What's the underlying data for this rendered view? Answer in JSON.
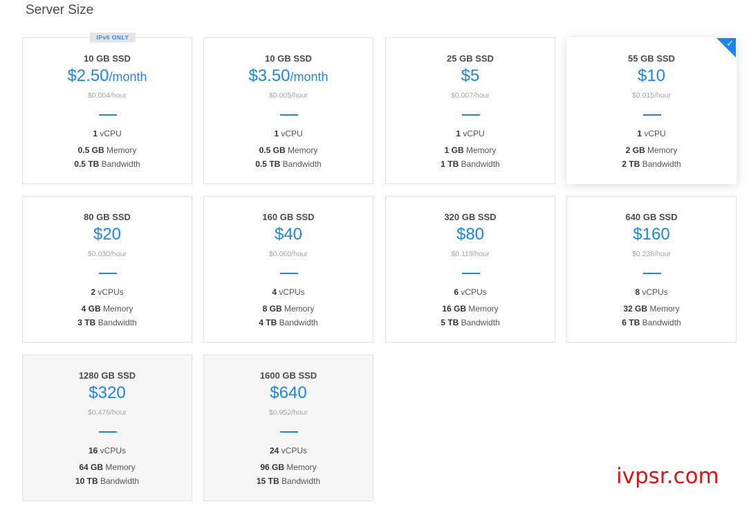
{
  "section_title": "Server Size",
  "plans": [
    {
      "storage": "10 GB SSD",
      "price": "$2.50",
      "unit": "/month",
      "hourly": "$0.004/hour",
      "cpu_num": "1",
      "cpu_label": "vCPU",
      "mem_num": "0.5 GB",
      "mem_label": "Memory",
      "bw_num": "0.5 TB",
      "bw_label": "Bandwidth",
      "badge": "IPv6 ONLY"
    },
    {
      "storage": "10 GB SSD",
      "price": "$3.50",
      "unit": "/month",
      "hourly": "$0.005/hour",
      "cpu_num": "1",
      "cpu_label": "vCPU",
      "mem_num": "0.5 GB",
      "mem_label": "Memory",
      "bw_num": "0.5 TB",
      "bw_label": "Bandwidth"
    },
    {
      "storage": "25 GB SSD",
      "price": "$5",
      "unit": "",
      "hourly": "$0.007/hour",
      "cpu_num": "1",
      "cpu_label": "vCPU",
      "mem_num": "1 GB",
      "mem_label": "Memory",
      "bw_num": "1 TB",
      "bw_label": "Bandwidth"
    },
    {
      "storage": "55 GB SSD",
      "price": "$10",
      "unit": "",
      "hourly": "$0.015/hour",
      "cpu_num": "1",
      "cpu_label": "vCPU",
      "mem_num": "2 GB",
      "mem_label": "Memory",
      "bw_num": "2 TB",
      "bw_label": "Bandwidth",
      "selected": true
    },
    {
      "storage": "80 GB SSD",
      "price": "$20",
      "unit": "",
      "hourly": "$0.030/hour",
      "cpu_num": "2",
      "cpu_label": "vCPUs",
      "mem_num": "4 GB",
      "mem_label": "Memory",
      "bw_num": "3 TB",
      "bw_label": "Bandwidth"
    },
    {
      "storage": "160 GB SSD",
      "price": "$40",
      "unit": "",
      "hourly": "$0.060/hour",
      "cpu_num": "4",
      "cpu_label": "vCPUs",
      "mem_num": "8 GB",
      "mem_label": "Memory",
      "bw_num": "4 TB",
      "bw_label": "Bandwidth"
    },
    {
      "storage": "320 GB SSD",
      "price": "$80",
      "unit": "",
      "hourly": "$0.119/hour",
      "cpu_num": "6",
      "cpu_label": "vCPUs",
      "mem_num": "16 GB",
      "mem_label": "Memory",
      "bw_num": "5 TB",
      "bw_label": "Bandwidth"
    },
    {
      "storage": "640 GB SSD",
      "price": "$160",
      "unit": "",
      "hourly": "$0.238/hour",
      "cpu_num": "8",
      "cpu_label": "vCPUs",
      "mem_num": "32 GB",
      "mem_label": "Memory",
      "bw_num": "6 TB",
      "bw_label": "Bandwidth"
    },
    {
      "storage": "1280 GB SSD",
      "price": "$320",
      "unit": "",
      "hourly": "$0.476/hour",
      "cpu_num": "16",
      "cpu_label": "vCPUs",
      "mem_num": "64 GB",
      "mem_label": "Memory",
      "bw_num": "10 TB",
      "bw_label": "Bandwidth",
      "disabled": true
    },
    {
      "storage": "1600 GB SSD",
      "price": "$640",
      "unit": "",
      "hourly": "$0.952/hour",
      "cpu_num": "24",
      "cpu_label": "vCPUs",
      "mem_num": "96 GB",
      "mem_label": "Memory",
      "bw_num": "15 TB",
      "bw_label": "Bandwidth",
      "disabled": true
    }
  ],
  "selected_icon": "check-icon",
  "watermark": "ivpsr.com",
  "colors": {
    "accent": "#1a85ee",
    "watermark": "#e01212"
  }
}
